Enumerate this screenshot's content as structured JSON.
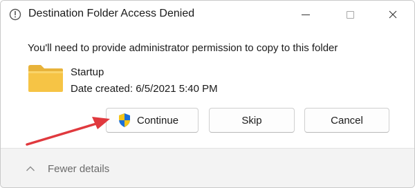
{
  "window": {
    "title": "Destination Folder Access Denied",
    "controls": [
      "minimize-icon",
      "maximize-icon",
      "close-icon"
    ]
  },
  "dialog": {
    "message": "You'll need to provide administrator permission to copy to this folder",
    "item": {
      "icon": "folder-icon",
      "name": "Startup",
      "date_created": "Date created: 6/5/2021 5:40 PM"
    }
  },
  "buttons": {
    "continue": {
      "label": "Continue",
      "icon": "uac-shield-icon"
    },
    "skip": {
      "label": "Skip"
    },
    "cancel": {
      "label": "Cancel"
    }
  },
  "footer": {
    "toggle_label": "Fewer details",
    "toggle_icon": "chevron-up-icon"
  },
  "annotation": {
    "icon": "red-arrow-icon",
    "color": "#e0393e"
  },
  "colors": {
    "folder": "#f6c445",
    "shield_blue": "#1a6fd8",
    "shield_yellow": "#f5c518"
  }
}
